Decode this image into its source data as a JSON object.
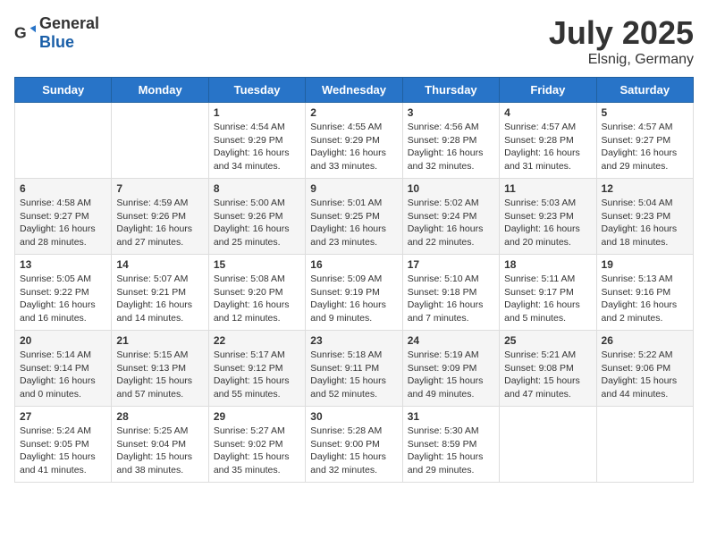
{
  "header": {
    "logo_general": "General",
    "logo_blue": "Blue",
    "month_title": "July 2025",
    "location": "Elsnig, Germany"
  },
  "weekdays": [
    "Sunday",
    "Monday",
    "Tuesday",
    "Wednesday",
    "Thursday",
    "Friday",
    "Saturday"
  ],
  "weeks": [
    [
      {
        "day": "",
        "info": ""
      },
      {
        "day": "",
        "info": ""
      },
      {
        "day": "1",
        "info": "Sunrise: 4:54 AM\nSunset: 9:29 PM\nDaylight: 16 hours\nand 34 minutes."
      },
      {
        "day": "2",
        "info": "Sunrise: 4:55 AM\nSunset: 9:29 PM\nDaylight: 16 hours\nand 33 minutes."
      },
      {
        "day": "3",
        "info": "Sunrise: 4:56 AM\nSunset: 9:28 PM\nDaylight: 16 hours\nand 32 minutes."
      },
      {
        "day": "4",
        "info": "Sunrise: 4:57 AM\nSunset: 9:28 PM\nDaylight: 16 hours\nand 31 minutes."
      },
      {
        "day": "5",
        "info": "Sunrise: 4:57 AM\nSunset: 9:27 PM\nDaylight: 16 hours\nand 29 minutes."
      }
    ],
    [
      {
        "day": "6",
        "info": "Sunrise: 4:58 AM\nSunset: 9:27 PM\nDaylight: 16 hours\nand 28 minutes."
      },
      {
        "day": "7",
        "info": "Sunrise: 4:59 AM\nSunset: 9:26 PM\nDaylight: 16 hours\nand 27 minutes."
      },
      {
        "day": "8",
        "info": "Sunrise: 5:00 AM\nSunset: 9:26 PM\nDaylight: 16 hours\nand 25 minutes."
      },
      {
        "day": "9",
        "info": "Sunrise: 5:01 AM\nSunset: 9:25 PM\nDaylight: 16 hours\nand 23 minutes."
      },
      {
        "day": "10",
        "info": "Sunrise: 5:02 AM\nSunset: 9:24 PM\nDaylight: 16 hours\nand 22 minutes."
      },
      {
        "day": "11",
        "info": "Sunrise: 5:03 AM\nSunset: 9:23 PM\nDaylight: 16 hours\nand 20 minutes."
      },
      {
        "day": "12",
        "info": "Sunrise: 5:04 AM\nSunset: 9:23 PM\nDaylight: 16 hours\nand 18 minutes."
      }
    ],
    [
      {
        "day": "13",
        "info": "Sunrise: 5:05 AM\nSunset: 9:22 PM\nDaylight: 16 hours\nand 16 minutes."
      },
      {
        "day": "14",
        "info": "Sunrise: 5:07 AM\nSunset: 9:21 PM\nDaylight: 16 hours\nand 14 minutes."
      },
      {
        "day": "15",
        "info": "Sunrise: 5:08 AM\nSunset: 9:20 PM\nDaylight: 16 hours\nand 12 minutes."
      },
      {
        "day": "16",
        "info": "Sunrise: 5:09 AM\nSunset: 9:19 PM\nDaylight: 16 hours\nand 9 minutes."
      },
      {
        "day": "17",
        "info": "Sunrise: 5:10 AM\nSunset: 9:18 PM\nDaylight: 16 hours\nand 7 minutes."
      },
      {
        "day": "18",
        "info": "Sunrise: 5:11 AM\nSunset: 9:17 PM\nDaylight: 16 hours\nand 5 minutes."
      },
      {
        "day": "19",
        "info": "Sunrise: 5:13 AM\nSunset: 9:16 PM\nDaylight: 16 hours\nand 2 minutes."
      }
    ],
    [
      {
        "day": "20",
        "info": "Sunrise: 5:14 AM\nSunset: 9:14 PM\nDaylight: 16 hours\nand 0 minutes."
      },
      {
        "day": "21",
        "info": "Sunrise: 5:15 AM\nSunset: 9:13 PM\nDaylight: 15 hours\nand 57 minutes."
      },
      {
        "day": "22",
        "info": "Sunrise: 5:17 AM\nSunset: 9:12 PM\nDaylight: 15 hours\nand 55 minutes."
      },
      {
        "day": "23",
        "info": "Sunrise: 5:18 AM\nSunset: 9:11 PM\nDaylight: 15 hours\nand 52 minutes."
      },
      {
        "day": "24",
        "info": "Sunrise: 5:19 AM\nSunset: 9:09 PM\nDaylight: 15 hours\nand 49 minutes."
      },
      {
        "day": "25",
        "info": "Sunrise: 5:21 AM\nSunset: 9:08 PM\nDaylight: 15 hours\nand 47 minutes."
      },
      {
        "day": "26",
        "info": "Sunrise: 5:22 AM\nSunset: 9:06 PM\nDaylight: 15 hours\nand 44 minutes."
      }
    ],
    [
      {
        "day": "27",
        "info": "Sunrise: 5:24 AM\nSunset: 9:05 PM\nDaylight: 15 hours\nand 41 minutes."
      },
      {
        "day": "28",
        "info": "Sunrise: 5:25 AM\nSunset: 9:04 PM\nDaylight: 15 hours\nand 38 minutes."
      },
      {
        "day": "29",
        "info": "Sunrise: 5:27 AM\nSunset: 9:02 PM\nDaylight: 15 hours\nand 35 minutes."
      },
      {
        "day": "30",
        "info": "Sunrise: 5:28 AM\nSunset: 9:00 PM\nDaylight: 15 hours\nand 32 minutes."
      },
      {
        "day": "31",
        "info": "Sunrise: 5:30 AM\nSunset: 8:59 PM\nDaylight: 15 hours\nand 29 minutes."
      },
      {
        "day": "",
        "info": ""
      },
      {
        "day": "",
        "info": ""
      }
    ]
  ]
}
